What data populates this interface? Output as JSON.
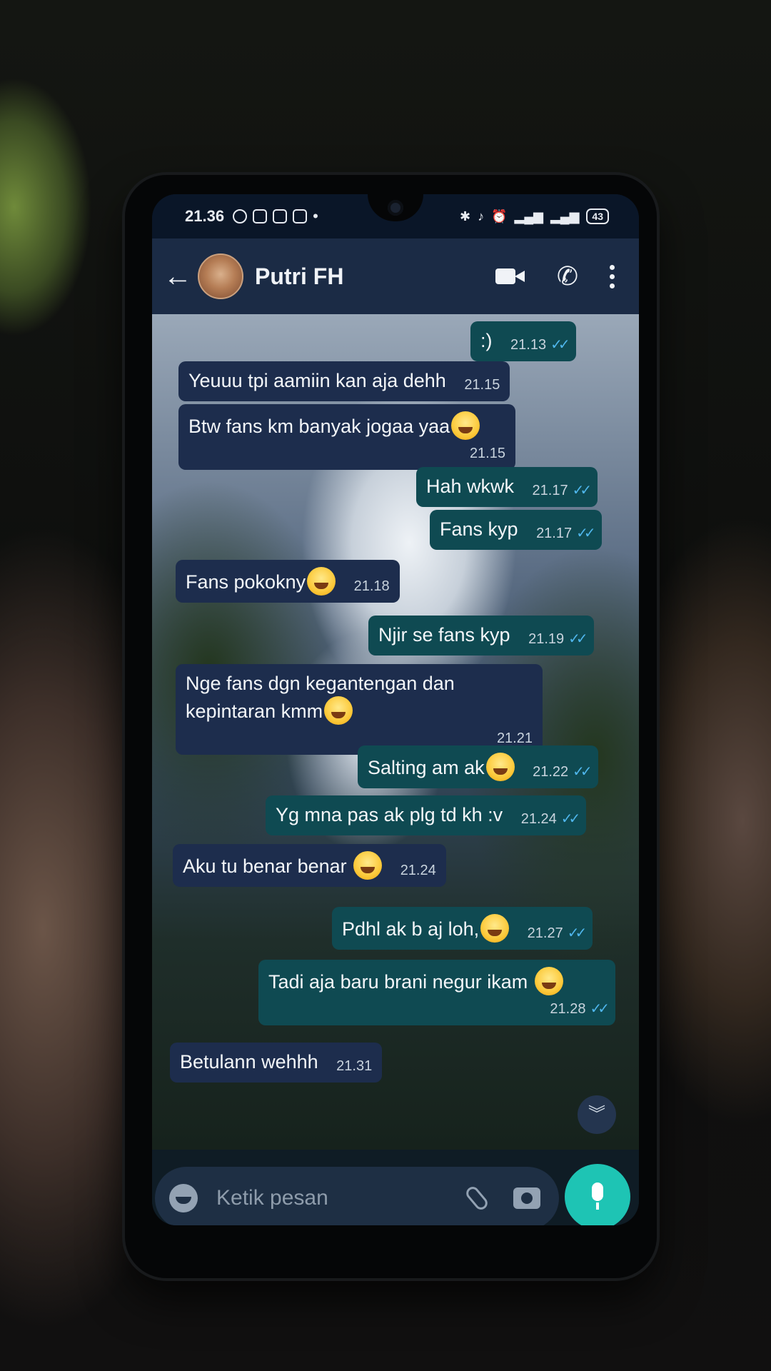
{
  "status_bar": {
    "time": "21.36",
    "battery": "43"
  },
  "header": {
    "contact_name": "Putri FH",
    "back_icon": "arrow-left-icon",
    "video_icon": "video-call-icon",
    "call_icon": "phone-icon",
    "menu_icon": "more-vert-icon"
  },
  "messages": [
    {
      "direction": "out",
      "text": ":)",
      "time": "21.13",
      "read": true
    },
    {
      "direction": "in",
      "text": "Yeuuu tpi aamiin kan aja dehh",
      "time": "21.15"
    },
    {
      "direction": "in",
      "text": "Btw fans km banyak jogaa yaa",
      "emoji": "laughing-tears",
      "time": "21.15"
    },
    {
      "direction": "out",
      "text": "Hah wkwk",
      "time": "21.17",
      "read": true
    },
    {
      "direction": "out",
      "text": "Fans kyp",
      "time": "21.17",
      "read": true
    },
    {
      "direction": "in",
      "text": "Fans pokokny",
      "emoji": "rolling-laughing",
      "time": "21.18"
    },
    {
      "direction": "out",
      "text": "Njir se fans kyp",
      "time": "21.19",
      "read": true
    },
    {
      "direction": "in",
      "text": "Nge fans dgn kegantengan dan kepintaran kmm",
      "emoji": "laughing-tears",
      "time": "21.21"
    },
    {
      "direction": "out",
      "text": "Salting am ak",
      "emoji": "laughing-tears",
      "time": "21.22",
      "read": true
    },
    {
      "direction": "out",
      "text": "Yg mna pas ak plg td kh :v",
      "time": "21.24",
      "read": true
    },
    {
      "direction": "in",
      "text": "Aku tu benar benar ",
      "emoji": "rolling-laughing",
      "time": "21.24"
    },
    {
      "direction": "out",
      "text": "Pdhl ak b aj loh,",
      "emoji": "smiling-face",
      "time": "21.27",
      "read": true
    },
    {
      "direction": "out",
      "text": "Tadi aja baru brani negur ikam ",
      "emoji": "laughing-tears",
      "time": "21.28",
      "read": true
    },
    {
      "direction": "in",
      "text": "Betulann wehhh",
      "time": "21.31"
    }
  ],
  "composer": {
    "placeholder": "Ketik pesan",
    "emoji_icon": "emoji-icon",
    "attach_icon": "paperclip-icon",
    "camera_icon": "camera-icon",
    "mic_icon": "microphone-icon"
  },
  "colors": {
    "incoming_bubble": "#1d2d4d",
    "outgoing_bubble": "#0f4a52",
    "read_ticks": "#4fb6ec",
    "mic_button": "#1ec4b4"
  }
}
